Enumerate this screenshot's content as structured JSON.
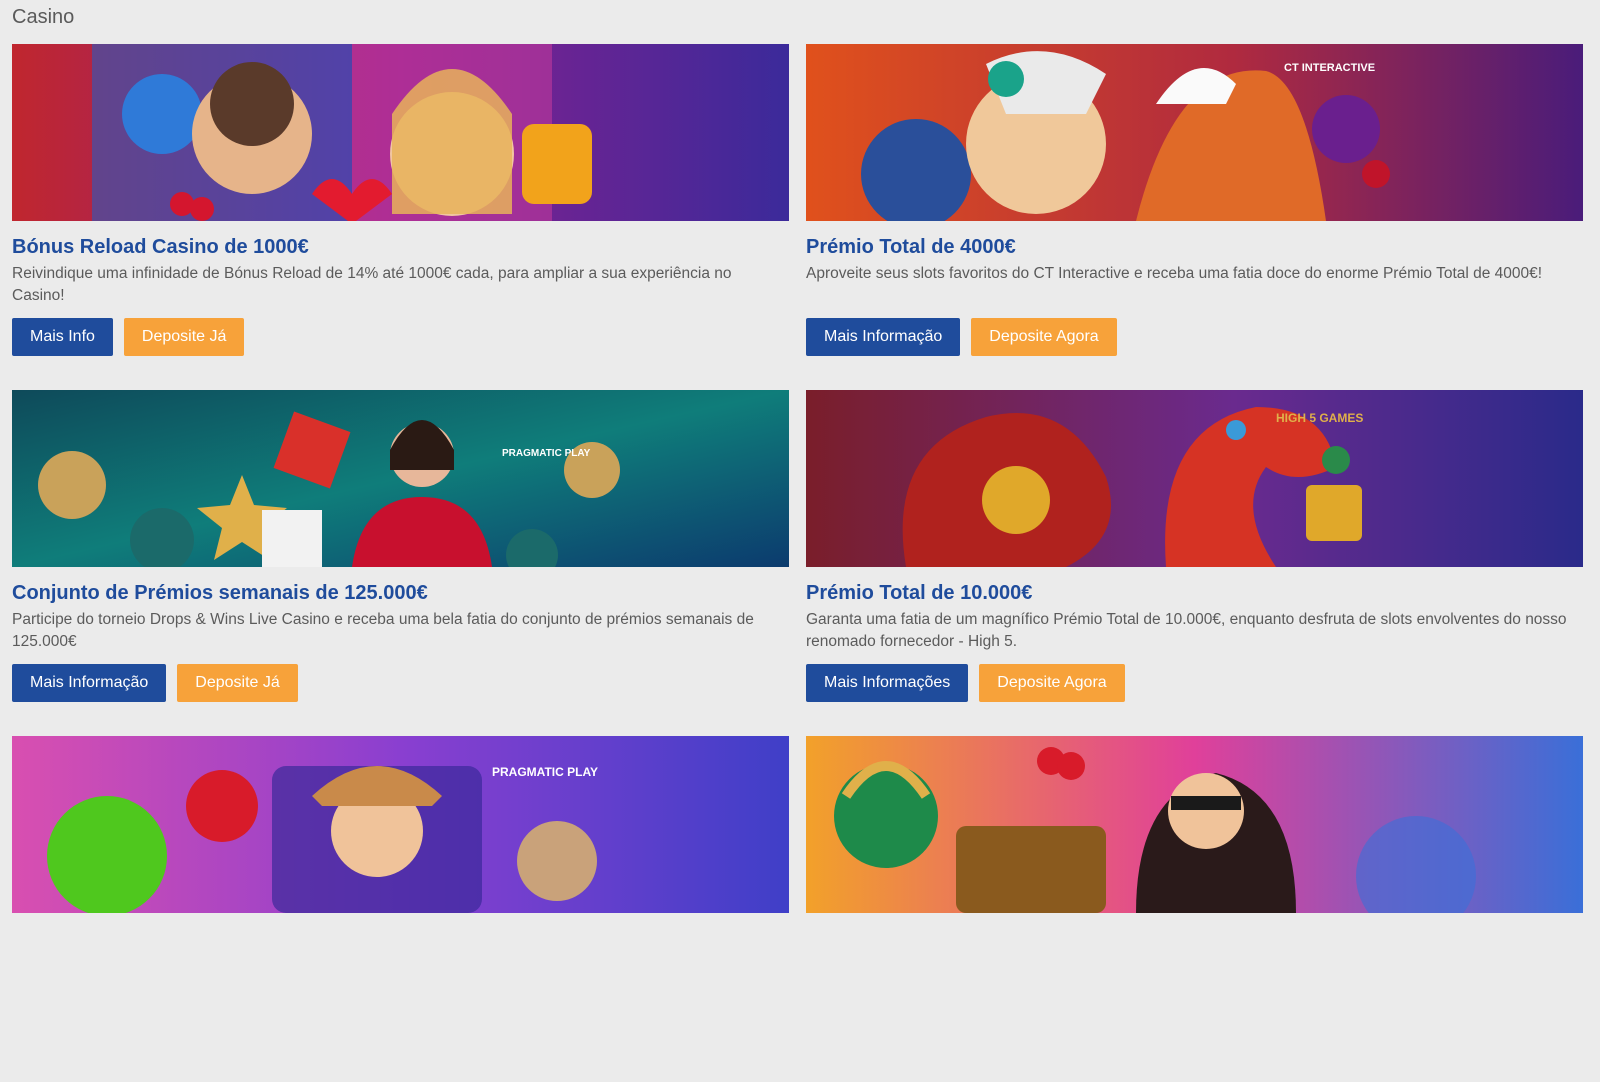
{
  "section_title": "Casino",
  "promos": [
    {
      "title": "Bónus Reload Casino de 1000€",
      "description": "Reivindique uma infinidade de Bónus Reload de 14% até 1000€ cada, para ampliar a sua experiência no Casino!",
      "primary_label": "Mais Info",
      "secondary_label": "Deposite Já",
      "banner_colors": [
        "#c0262e",
        "#7a1f8e",
        "#3b2a9a"
      ]
    },
    {
      "title": "Prémio Total de 4000€",
      "description": "Aproveite seus slots favoritos do CT Interactive e receba uma fatia doce do enorme Prémio Total de 4000€!",
      "primary_label": "Mais Informação",
      "secondary_label": "Deposite Agora",
      "banner_brand": "CT INTERACTIVE",
      "banner_colors": [
        "#e0511c",
        "#b02a3f",
        "#4a1c7a"
      ]
    },
    {
      "title": "Conjunto de Prémios semanais de 125.000€",
      "description": "Participe do torneio Drops & Wins Live Casino e receba uma bela fatia do conjunto de prémios semanais de 125.000€",
      "primary_label": "Mais Informação",
      "secondary_label": "Deposite Já",
      "banner_brand": "PRAGMATIC PLAY",
      "banner_colors": [
        "#0e4a5a",
        "#0f7d7a",
        "#0c3b6e"
      ]
    },
    {
      "title": "Prémio Total de 10.000€",
      "description": "Garanta uma fatia de um magnífico Prémio Total de 10.000€, enquanto desfruta de slots envolventes do nosso renomado fornecedor - High 5.",
      "primary_label": "Mais Informações",
      "secondary_label": "Deposite Agora",
      "banner_brand": "HIGH 5 GAMES",
      "banner_colors": [
        "#7a1e2a",
        "#6a2a8e",
        "#2a2a8a"
      ]
    },
    {
      "banner_brand": "PRAGMATIC PLAY",
      "banner_colors": [
        "#d94fb0",
        "#8a3fd0",
        "#3f3fc8"
      ]
    },
    {
      "banner_colors": [
        "#f2a12a",
        "#e0409a",
        "#3a6fd8"
      ]
    }
  ],
  "colors": {
    "primary": "#1f4c9c",
    "accent": "#f7a23a",
    "background": "#ebebeb"
  }
}
